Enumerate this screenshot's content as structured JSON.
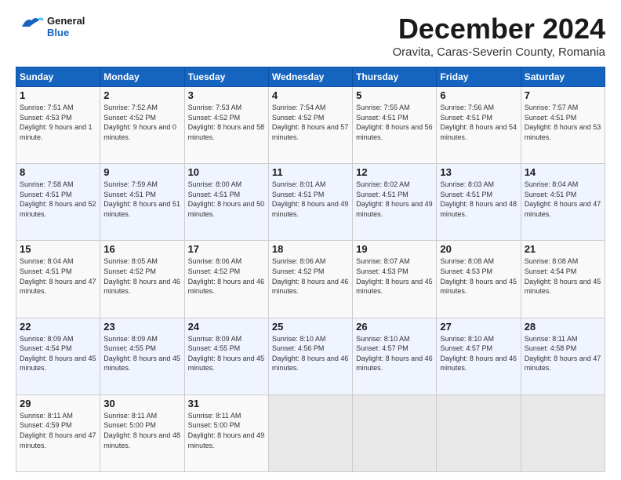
{
  "header": {
    "logo_line1": "General",
    "logo_line2": "Blue",
    "title": "December 2024",
    "subtitle": "Oravita, Caras-Severin County, Romania"
  },
  "calendar": {
    "days_of_week": [
      "Sunday",
      "Monday",
      "Tuesday",
      "Wednesday",
      "Thursday",
      "Friday",
      "Saturday"
    ],
    "weeks": [
      [
        {
          "day": "",
          "empty": true
        },
        {
          "day": "",
          "empty": true
        },
        {
          "day": "",
          "empty": true
        },
        {
          "day": "",
          "empty": true
        },
        {
          "day": "",
          "empty": true
        },
        {
          "day": "",
          "empty": true
        },
        {
          "day": "",
          "empty": true
        }
      ],
      [
        {
          "day": "1",
          "sunrise": "Sunrise: 7:51 AM",
          "sunset": "Sunset: 4:53 PM",
          "daylight": "Daylight: 9 hours and 1 minute."
        },
        {
          "day": "2",
          "sunrise": "Sunrise: 7:52 AM",
          "sunset": "Sunset: 4:52 PM",
          "daylight": "Daylight: 9 hours and 0 minutes."
        },
        {
          "day": "3",
          "sunrise": "Sunrise: 7:53 AM",
          "sunset": "Sunset: 4:52 PM",
          "daylight": "Daylight: 8 hours and 58 minutes."
        },
        {
          "day": "4",
          "sunrise": "Sunrise: 7:54 AM",
          "sunset": "Sunset: 4:52 PM",
          "daylight": "Daylight: 8 hours and 57 minutes."
        },
        {
          "day": "5",
          "sunrise": "Sunrise: 7:55 AM",
          "sunset": "Sunset: 4:51 PM",
          "daylight": "Daylight: 8 hours and 56 minutes."
        },
        {
          "day": "6",
          "sunrise": "Sunrise: 7:56 AM",
          "sunset": "Sunset: 4:51 PM",
          "daylight": "Daylight: 8 hours and 54 minutes."
        },
        {
          "day": "7",
          "sunrise": "Sunrise: 7:57 AM",
          "sunset": "Sunset: 4:51 PM",
          "daylight": "Daylight: 8 hours and 53 minutes."
        }
      ],
      [
        {
          "day": "8",
          "sunrise": "Sunrise: 7:58 AM",
          "sunset": "Sunset: 4:51 PM",
          "daylight": "Daylight: 8 hours and 52 minutes."
        },
        {
          "day": "9",
          "sunrise": "Sunrise: 7:59 AM",
          "sunset": "Sunset: 4:51 PM",
          "daylight": "Daylight: 8 hours and 51 minutes."
        },
        {
          "day": "10",
          "sunrise": "Sunrise: 8:00 AM",
          "sunset": "Sunset: 4:51 PM",
          "daylight": "Daylight: 8 hours and 50 minutes."
        },
        {
          "day": "11",
          "sunrise": "Sunrise: 8:01 AM",
          "sunset": "Sunset: 4:51 PM",
          "daylight": "Daylight: 8 hours and 49 minutes."
        },
        {
          "day": "12",
          "sunrise": "Sunrise: 8:02 AM",
          "sunset": "Sunset: 4:51 PM",
          "daylight": "Daylight: 8 hours and 49 minutes."
        },
        {
          "day": "13",
          "sunrise": "Sunrise: 8:03 AM",
          "sunset": "Sunset: 4:51 PM",
          "daylight": "Daylight: 8 hours and 48 minutes."
        },
        {
          "day": "14",
          "sunrise": "Sunrise: 8:04 AM",
          "sunset": "Sunset: 4:51 PM",
          "daylight": "Daylight: 8 hours and 47 minutes."
        }
      ],
      [
        {
          "day": "15",
          "sunrise": "Sunrise: 8:04 AM",
          "sunset": "Sunset: 4:51 PM",
          "daylight": "Daylight: 8 hours and 47 minutes."
        },
        {
          "day": "16",
          "sunrise": "Sunrise: 8:05 AM",
          "sunset": "Sunset: 4:52 PM",
          "daylight": "Daylight: 8 hours and 46 minutes."
        },
        {
          "day": "17",
          "sunrise": "Sunrise: 8:06 AM",
          "sunset": "Sunset: 4:52 PM",
          "daylight": "Daylight: 8 hours and 46 minutes."
        },
        {
          "day": "18",
          "sunrise": "Sunrise: 8:06 AM",
          "sunset": "Sunset: 4:52 PM",
          "daylight": "Daylight: 8 hours and 46 minutes."
        },
        {
          "day": "19",
          "sunrise": "Sunrise: 8:07 AM",
          "sunset": "Sunset: 4:53 PM",
          "daylight": "Daylight: 8 hours and 45 minutes."
        },
        {
          "day": "20",
          "sunrise": "Sunrise: 8:08 AM",
          "sunset": "Sunset: 4:53 PM",
          "daylight": "Daylight: 8 hours and 45 minutes."
        },
        {
          "day": "21",
          "sunrise": "Sunrise: 8:08 AM",
          "sunset": "Sunset: 4:54 PM",
          "daylight": "Daylight: 8 hours and 45 minutes."
        }
      ],
      [
        {
          "day": "22",
          "sunrise": "Sunrise: 8:09 AM",
          "sunset": "Sunset: 4:54 PM",
          "daylight": "Daylight: 8 hours and 45 minutes."
        },
        {
          "day": "23",
          "sunrise": "Sunrise: 8:09 AM",
          "sunset": "Sunset: 4:55 PM",
          "daylight": "Daylight: 8 hours and 45 minutes."
        },
        {
          "day": "24",
          "sunrise": "Sunrise: 8:09 AM",
          "sunset": "Sunset: 4:55 PM",
          "daylight": "Daylight: 8 hours and 45 minutes."
        },
        {
          "day": "25",
          "sunrise": "Sunrise: 8:10 AM",
          "sunset": "Sunset: 4:56 PM",
          "daylight": "Daylight: 8 hours and 46 minutes."
        },
        {
          "day": "26",
          "sunrise": "Sunrise: 8:10 AM",
          "sunset": "Sunset: 4:57 PM",
          "daylight": "Daylight: 8 hours and 46 minutes."
        },
        {
          "day": "27",
          "sunrise": "Sunrise: 8:10 AM",
          "sunset": "Sunset: 4:57 PM",
          "daylight": "Daylight: 8 hours and 46 minutes."
        },
        {
          "day": "28",
          "sunrise": "Sunrise: 8:11 AM",
          "sunset": "Sunset: 4:58 PM",
          "daylight": "Daylight: 8 hours and 47 minutes."
        }
      ],
      [
        {
          "day": "29",
          "sunrise": "Sunrise: 8:11 AM",
          "sunset": "Sunset: 4:59 PM",
          "daylight": "Daylight: 8 hours and 47 minutes."
        },
        {
          "day": "30",
          "sunrise": "Sunrise: 8:11 AM",
          "sunset": "Sunset: 5:00 PM",
          "daylight": "Daylight: 8 hours and 48 minutes."
        },
        {
          "day": "31",
          "sunrise": "Sunrise: 8:11 AM",
          "sunset": "Sunset: 5:00 PM",
          "daylight": "Daylight: 8 hours and 49 minutes."
        },
        {
          "day": "",
          "empty": true
        },
        {
          "day": "",
          "empty": true
        },
        {
          "day": "",
          "empty": true
        },
        {
          "day": "",
          "empty": true
        }
      ]
    ]
  }
}
